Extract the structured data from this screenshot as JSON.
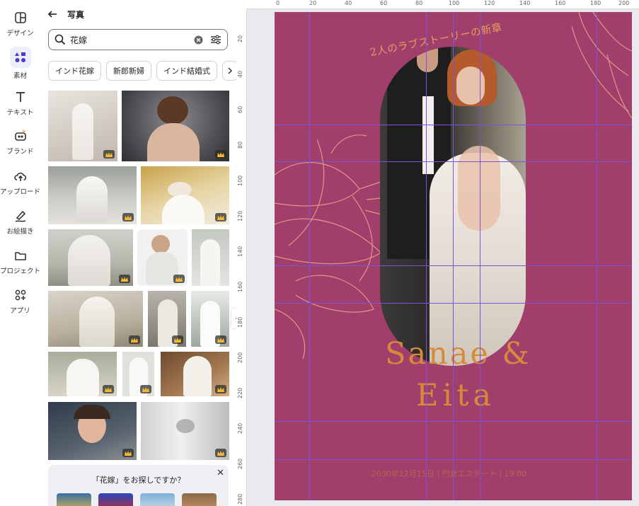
{
  "rail": {
    "items": [
      {
        "label": "デザイン",
        "icon": "layout-icon"
      },
      {
        "label": "素材",
        "icon": "elements-icon"
      },
      {
        "label": "テキスト",
        "icon": "text-icon"
      },
      {
        "label": "ブランド",
        "icon": "brand-icon"
      },
      {
        "label": "アップロード",
        "icon": "upload-icon"
      },
      {
        "label": "お絵描き",
        "icon": "draw-icon"
      },
      {
        "label": "プロジェクト",
        "icon": "folder-icon"
      },
      {
        "label": "アプリ",
        "icon": "apps-icon"
      }
    ]
  },
  "panel": {
    "title": "写真",
    "search": {
      "value": "花嫁"
    },
    "chips": [
      "インド花嫁",
      "新郎新婦",
      "インド結婚式"
    ],
    "suggest": {
      "text": "「花嫁」をお探しですか？"
    }
  },
  "rulers": {
    "top": [
      "0",
      "20",
      "40",
      "60",
      "80",
      "100",
      "120",
      "140",
      "160",
      "180",
      "200"
    ],
    "left": [
      "20",
      "40",
      "60",
      "80",
      "100",
      "120",
      "140",
      "160",
      "180",
      "200",
      "220",
      "240",
      "260",
      "280"
    ]
  },
  "design": {
    "background": "#a13e6c",
    "subtitle": "2人のラブストーリーの新章",
    "name_line1": "Sanae &",
    "name_line2": "Eita",
    "info": "2030年12月15日 | 門倉エステート | 19:00"
  },
  "colors": {
    "accent": "#7b53d6",
    "gold": "#d78a3c"
  }
}
